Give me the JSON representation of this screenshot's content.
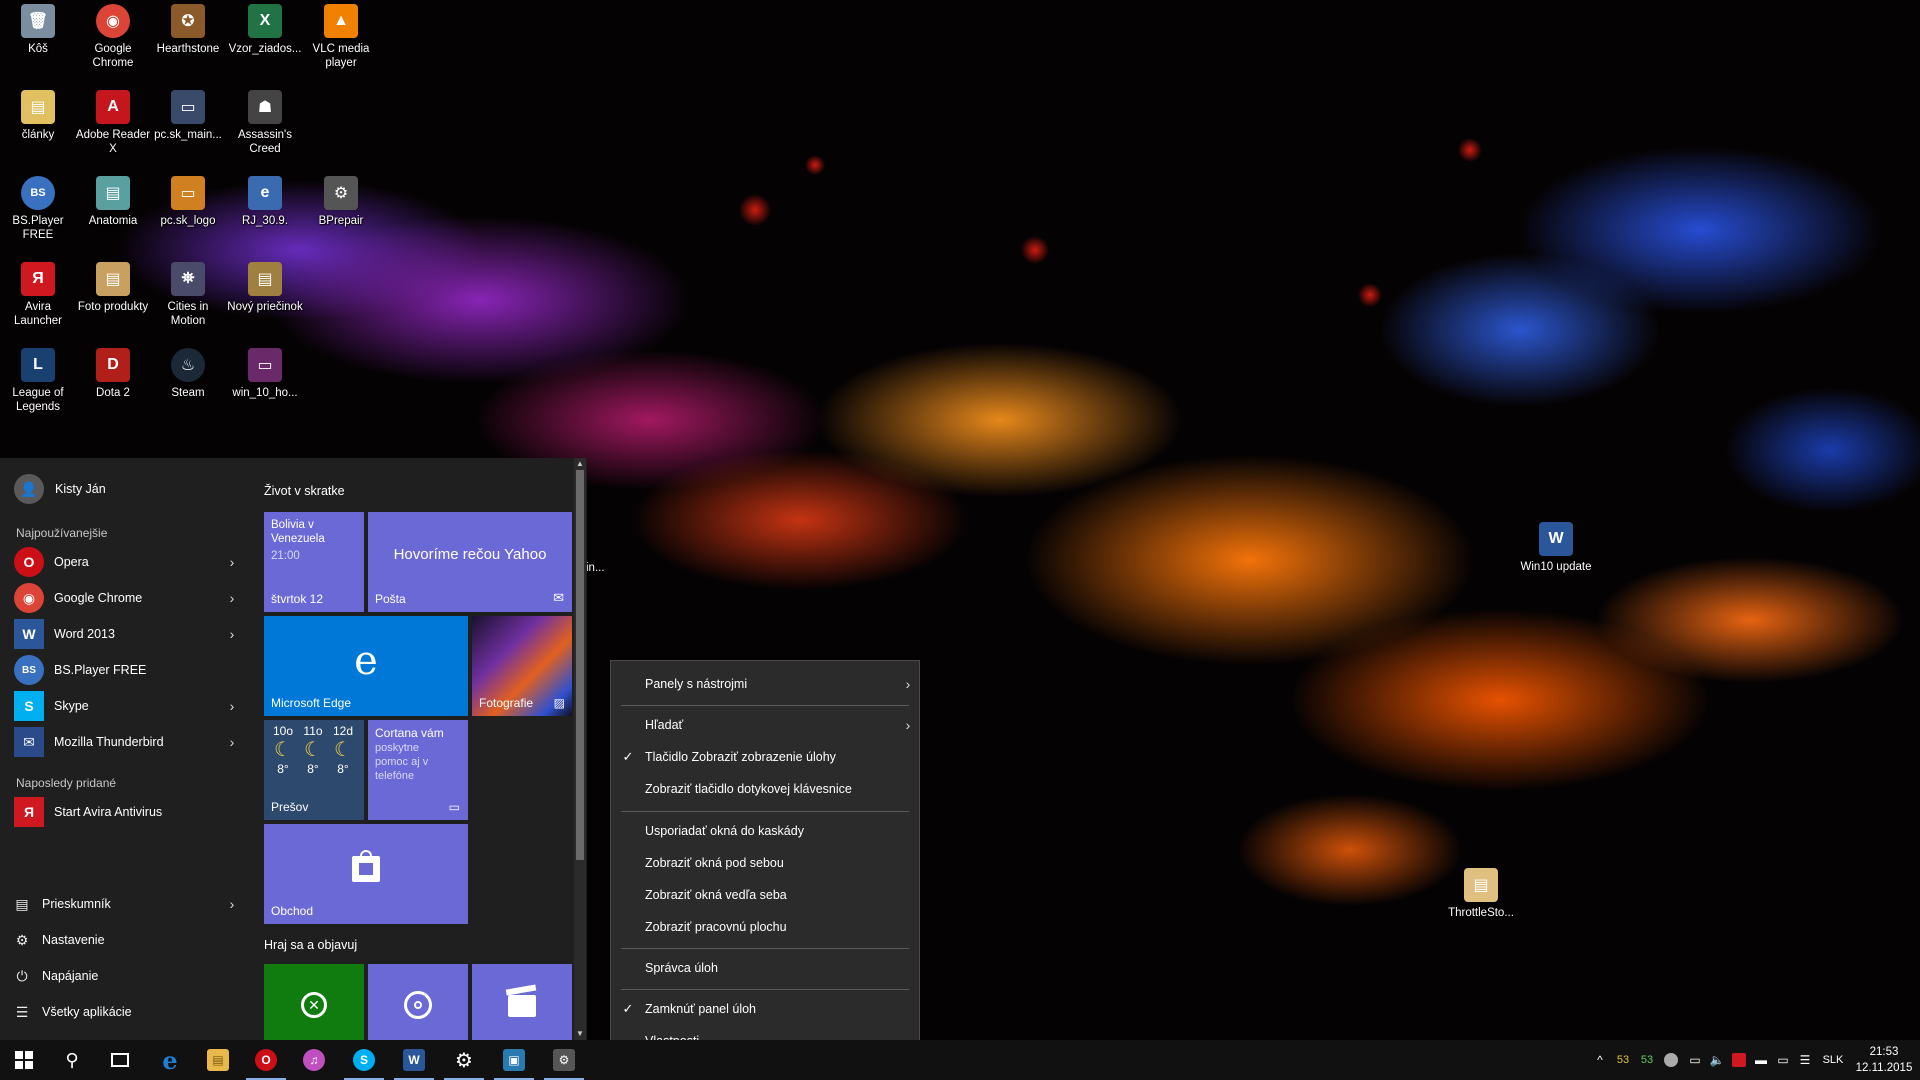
{
  "desktop": {
    "icons": [
      {
        "label": "Kôš",
        "icon": "recycle-bin-icon",
        "color": "#7a8ea0",
        "glyph": "🗑"
      },
      {
        "label": "Google Chrome",
        "icon": "chrome-icon",
        "color": "#db4437",
        "glyph": "◉"
      },
      {
        "label": "Hearthstone",
        "icon": "hearthstone-icon",
        "color": "#8a5a2a",
        "glyph": "✪"
      },
      {
        "label": "Vzor_ziados...",
        "icon": "excel-file-icon",
        "color": "#217346",
        "glyph": "X"
      },
      {
        "label": "VLC media player",
        "icon": "vlc-icon",
        "color": "#f08000",
        "glyph": "▲"
      },
      {
        "label": "články",
        "icon": "folder-icon",
        "color": "#e0c060",
        "glyph": "▤"
      },
      {
        "label": "Adobe Reader X",
        "icon": "adobe-reader-icon",
        "color": "#c4161c",
        "glyph": "A"
      },
      {
        "label": "pc.sk_main...",
        "icon": "image-file-icon",
        "color": "#3a4a6a",
        "glyph": "▭"
      },
      {
        "label": "Assassin's Creed",
        "icon": "assassins-creed-icon",
        "color": "#444",
        "glyph": "☗"
      },
      {
        "label": "BS.Player FREE",
        "icon": "bsplayer-icon",
        "color": "#3a70c0",
        "glyph": "BS"
      },
      {
        "label": "Anatomia",
        "icon": "folder-icon",
        "color": "#5aa0a0",
        "glyph": "▤"
      },
      {
        "label": "pc.sk_logo",
        "icon": "image-file-icon",
        "color": "#d08020",
        "glyph": "▭"
      },
      {
        "label": "RJ_30.9.",
        "icon": "pdf-file-icon",
        "color": "#3a6ab0",
        "glyph": "e"
      },
      {
        "label": "BPrepair",
        "icon": "bprepair-icon",
        "color": "#555",
        "glyph": "⚙"
      },
      {
        "label": "Avira Launcher",
        "icon": "avira-icon",
        "color": "#d01820",
        "glyph": "Я"
      },
      {
        "label": "Foto produkty",
        "icon": "folder-icon",
        "color": "#c8a060",
        "glyph": "▤"
      },
      {
        "label": "Cities in Motion",
        "icon": "cities-in-motion-icon",
        "color": "#4a4a6a",
        "glyph": "⛯"
      },
      {
        "label": "Nový priečinok",
        "icon": "folder-icon",
        "color": "#a08040",
        "glyph": "▤"
      },
      {
        "label": "League of Legends",
        "icon": "league-of-legends-icon",
        "color": "#1a4070",
        "glyph": "L"
      },
      {
        "label": "Dota 2",
        "icon": "dota2-icon",
        "color": "#b02018",
        "glyph": "D"
      },
      {
        "label": "Steam",
        "icon": "steam-icon",
        "color": "#1b2838",
        "glyph": "♨"
      },
      {
        "label": "win_10_ho...",
        "icon": "image-file-icon",
        "color": "#6a2a6a",
        "glyph": "▭"
      },
      {
        "label": "Win10 update",
        "icon": "word-file-icon",
        "color": "#2b579a",
        "glyph": "W"
      },
      {
        "label": "ThrottleSto...",
        "icon": "folder-icon",
        "color": "#e0c080",
        "glyph": "▤"
      }
    ],
    "partial_label": "in..."
  },
  "start_menu": {
    "user_name": "Kisty Ján",
    "most_used_title": "Najpoužívanejšie",
    "most_used": [
      {
        "label": "Opera",
        "icon": "opera-icon",
        "color": "#cc0f16",
        "glyph": "O",
        "chevron": "›"
      },
      {
        "label": "Google Chrome",
        "icon": "chrome-icon",
        "color": "#db4437",
        "glyph": "◉",
        "chevron": "›"
      },
      {
        "label": "Word 2013",
        "icon": "word-icon",
        "color": "#2b579a",
        "glyph": "W",
        "chevron": "›"
      },
      {
        "label": "BS.Player FREE",
        "icon": "bsplayer-icon",
        "color": "#3a70c0",
        "glyph": "BS",
        "chevron": ""
      },
      {
        "label": "Skype",
        "icon": "skype-icon",
        "color": "#00aff0",
        "glyph": "S",
        "chevron": "›"
      },
      {
        "label": "Mozilla Thunderbird",
        "icon": "thunderbird-icon",
        "color": "#2a4a8a",
        "glyph": "✉",
        "chevron": "›"
      }
    ],
    "recently_added_title": "Naposledy pridané",
    "recently_added": [
      {
        "label": "Start Avira Antivirus",
        "icon": "avira-icon",
        "color": "#d01820",
        "glyph": "Я"
      }
    ],
    "system_items": [
      {
        "label": "Prieskumník",
        "icon": "file-explorer-icon",
        "glyph": "▤",
        "chevron": "›"
      },
      {
        "label": "Nastavenie",
        "icon": "settings-gear-icon",
        "glyph": "⚙",
        "chevron": ""
      },
      {
        "label": "Napájanie",
        "icon": "power-icon",
        "glyph": "⏻",
        "chevron": ""
      },
      {
        "label": "Všetky aplikácie",
        "icon": "all-apps-icon",
        "glyph": "☰",
        "chevron": ""
      }
    ],
    "tiles": {
      "group1_title": "Život v skratke",
      "calendar": {
        "event": "Bolivia v Venezuela",
        "time": "21:00",
        "day": "štvrtok 12"
      },
      "mail": {
        "headline": "Hovoríme rečou Yahoo",
        "label": "Pošta"
      },
      "edge": {
        "label": "Microsoft Edge"
      },
      "photos": {
        "label": "Fotografie"
      },
      "weather": {
        "days": [
          {
            "day": "10o",
            "temp": "8°"
          },
          {
            "day": "11o",
            "temp": "8°"
          },
          {
            "day": "12d",
            "temp": "8°"
          }
        ],
        "location": "Prešov"
      },
      "cortana": {
        "title": "Cortana vám",
        "text": "poskytne pomoc aj v telefóne"
      },
      "store": {
        "label": "Obchod"
      },
      "group2_title": "Hraj sa a objavuj"
    }
  },
  "context_menu": {
    "items": [
      {
        "label": "Panely s nástrojmi",
        "checked": false,
        "submenu": true
      },
      {
        "label": "Hľadať",
        "checked": false,
        "submenu": true
      },
      {
        "label": "Tlačidlo Zobraziť zobrazenie úlohy",
        "checked": true,
        "submenu": false
      },
      {
        "label": "Zobraziť tlačidlo dotykovej klávesnice",
        "checked": false,
        "submenu": false
      },
      {
        "label": "Usporiadať okná do kaskády",
        "checked": false,
        "submenu": false
      },
      {
        "label": "Zobraziť okná pod sebou",
        "checked": false,
        "submenu": false
      },
      {
        "label": "Zobraziť okná vedľa seba",
        "checked": false,
        "submenu": false
      },
      {
        "label": "Zobraziť pracovnú plochu",
        "checked": false,
        "submenu": false
      },
      {
        "label": "Správca úloh",
        "checked": false,
        "submenu": false
      },
      {
        "label": "Zamknúť panel úloh",
        "checked": true,
        "submenu": false
      },
      {
        "label": "Vlastnosti",
        "checked": false,
        "submenu": false
      }
    ],
    "check_glyph": "✓",
    "arrow_glyph": "›"
  },
  "taskbar": {
    "pinned": [
      {
        "name": "edge-taskbar-button",
        "icon": "edge-icon",
        "color": "#1e7fd8",
        "glyph": "e",
        "running": false
      },
      {
        "name": "file-explorer-taskbar-button",
        "icon": "folder-icon",
        "color": "#e8b84a",
        "glyph": "▤",
        "running": false
      },
      {
        "name": "opera-taskbar-button",
        "icon": "opera-icon",
        "color": "#cc0f16",
        "glyph": "O",
        "running": true
      },
      {
        "name": "itunes-taskbar-button",
        "icon": "itunes-icon",
        "color": "#c050c0",
        "glyph": "♫",
        "running": false
      },
      {
        "name": "skype-taskbar-button",
        "icon": "skype-icon",
        "color": "#00aff0",
        "glyph": "S",
        "running": true
      },
      {
        "name": "word-taskbar-button",
        "icon": "word-icon",
        "color": "#2b579a",
        "glyph": "W",
        "running": true
      },
      {
        "name": "settings-taskbar-button",
        "icon": "settings-gear-icon",
        "color": "#111111",
        "glyph": "⚙",
        "running": true
      },
      {
        "name": "remote-desktop-taskbar-button",
        "icon": "remote-desktop-icon",
        "color": "#2a7ab0",
        "glyph": "▣",
        "running": true
      },
      {
        "name": "bprepair-taskbar-button",
        "icon": "bprepair-icon",
        "color": "#555555",
        "glyph": "⚙",
        "running": true
      }
    ],
    "tray": {
      "chevron": "^",
      "temp1": "53",
      "temp2": "53",
      "language": "SLK",
      "time": "21:53",
      "date": "12.11.2015"
    }
  },
  "colors": {
    "tile_purple": "#6b69d6",
    "tile_blue": "#0078d7",
    "tile_green": "#107c10",
    "tile_darkblue": "#2d4a6e"
  }
}
